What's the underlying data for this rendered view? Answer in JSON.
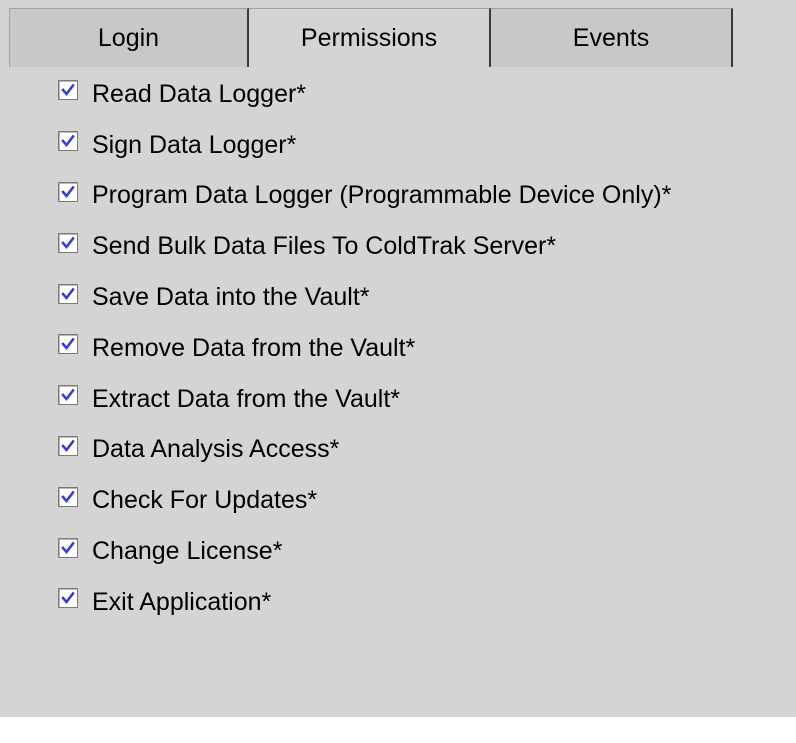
{
  "tabs": [
    {
      "label": "Login",
      "active": false
    },
    {
      "label": "Permissions",
      "active": true
    },
    {
      "label": "Events",
      "active": false
    }
  ],
  "permissions": [
    {
      "label": "Read Data Logger*",
      "checked": true
    },
    {
      "label": "Sign Data Logger*",
      "checked": true
    },
    {
      "label": "Program Data Logger (Programmable Device Only)*",
      "checked": true
    },
    {
      "label": "Send Bulk Data Files To ColdTrak Server*",
      "checked": true
    },
    {
      "label": "Save Data into the Vault*",
      "checked": true
    },
    {
      "label": "Remove Data from the Vault*",
      "checked": true
    },
    {
      "label": "Extract Data from the Vault*",
      "checked": true
    },
    {
      "label": "Data Analysis Access*",
      "checked": true
    },
    {
      "label": "Check For Updates*",
      "checked": true
    },
    {
      "label": "Change License*",
      "checked": true
    },
    {
      "label": "Exit Application*",
      "checked": true
    }
  ],
  "colors": {
    "background": "#d4d4d4",
    "tab_inactive": "#c8c8c8",
    "checkmark": "#3b3bd6"
  },
  "icons": {
    "checkbox": "checkmark-icon"
  }
}
